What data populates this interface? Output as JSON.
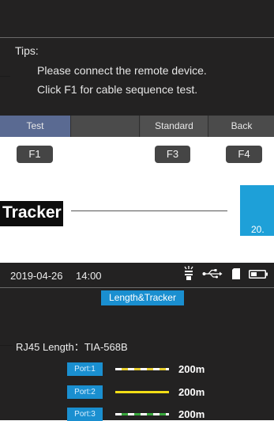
{
  "top_screen": {
    "tips_title": "Tips:",
    "tips_lines": [
      "Please connect the remote device.",
      "Click F1 for cable sequence test."
    ],
    "softkeys": [
      "Test",
      "",
      "Standard",
      "Back"
    ],
    "function_keys": [
      "F1",
      "F3",
      "F4"
    ]
  },
  "section": {
    "title": "Tracker",
    "page_number": "20."
  },
  "bottom_screen": {
    "status": {
      "date": "2019-04-26",
      "time": "14:00",
      "icons": [
        "flashlight-icon",
        "usb-icon",
        "sd-card-icon",
        "battery-icon"
      ]
    },
    "title": "Length&Tracker",
    "cable_label": "RJ45 Length：TIA-568B",
    "ports": [
      {
        "label": "Port:1",
        "length": "200m",
        "wire_style": "dashed",
        "wire_colors": [
          "#ffffff",
          "#e6cd2f"
        ]
      },
      {
        "label": "Port:2",
        "length": "200m",
        "wire_style": "solid",
        "wire_colors": [
          "#f2dd16"
        ]
      },
      {
        "label": "Port:3",
        "length": "200m",
        "wire_style": "dashed",
        "wire_colors": [
          "#ffffff",
          "#39a83d"
        ]
      }
    ]
  },
  "colors": {
    "screen_background": "#232222",
    "accent_blue": "#1a8fd0",
    "page_tab_blue": "#1ea0d8",
    "softkey_active": "#5a6a92"
  }
}
